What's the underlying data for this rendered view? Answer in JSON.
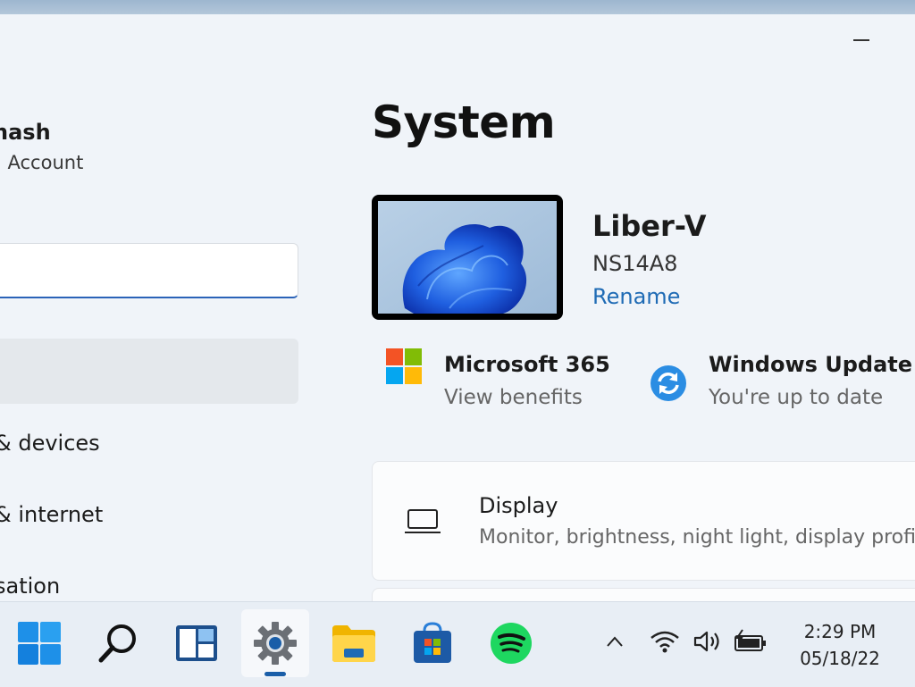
{
  "window": {
    "minimize_label": "Minimize"
  },
  "sidebar": {
    "user_name": "nash",
    "user_account": "l Account",
    "search": {
      "value": ""
    },
    "items": [
      {
        "label": "& devices"
      },
      {
        "label": "& internet"
      },
      {
        "label": "sation"
      }
    ]
  },
  "main": {
    "title": "System",
    "device": {
      "name": "Liber-V",
      "model": "NS14A8",
      "rename_label": "Rename"
    },
    "quick_links": [
      {
        "title": "Microsoft 365",
        "subtitle": "View benefits",
        "icon": "microsoft-365-icon"
      },
      {
        "title": "Windows Update",
        "subtitle": "You're up to date",
        "icon": "windows-update-icon"
      }
    ],
    "settings": [
      {
        "title": "Display",
        "subtitle": "Monitor, brightness, night light, display profil",
        "icon": "laptop-icon"
      }
    ]
  },
  "taskbar": {
    "apps": [
      {
        "name": "start",
        "icon": "windows-logo-icon"
      },
      {
        "name": "search",
        "icon": "search-icon"
      },
      {
        "name": "widgets",
        "icon": "widgets-icon"
      },
      {
        "name": "settings",
        "icon": "gear-icon",
        "active": true
      },
      {
        "name": "file-explorer",
        "icon": "folder-icon"
      },
      {
        "name": "microsoft-store",
        "icon": "store-icon"
      },
      {
        "name": "spotify",
        "icon": "spotify-icon"
      }
    ],
    "tray": [
      "chevron-up-icon",
      "wifi-icon",
      "volume-icon",
      "battery-icon"
    ],
    "clock": {
      "time": "2:29 PM",
      "date": "05/18/22"
    }
  },
  "colors": {
    "accent": "#1f6bb5",
    "window_bg": "#f0f4f9",
    "taskbar_bg": "#e8eef5",
    "active_indicator": "#1a5ea8",
    "spotify_green": "#1ed760"
  }
}
